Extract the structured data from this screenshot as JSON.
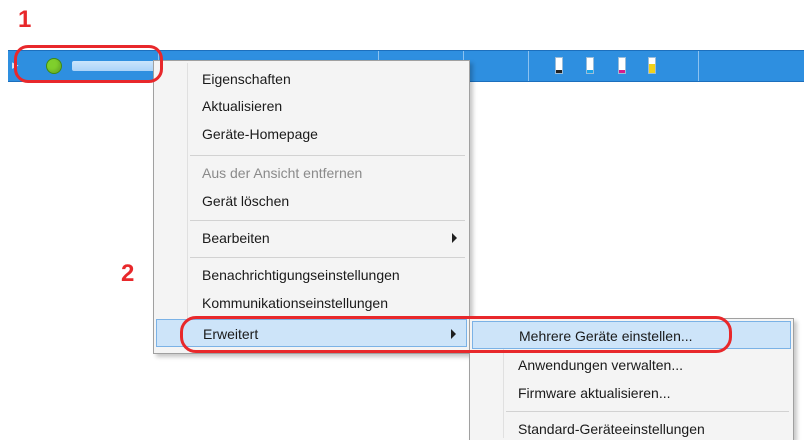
{
  "callouts": {
    "step1": "1",
    "step2": "2"
  },
  "colors": {
    "accent_red": "#e8282b",
    "row_blue": "#2e8fe0",
    "status_green": "#7fcf2c",
    "highlight": "#cde4f9"
  },
  "device_row": {
    "status_icon": "green-status-dot-icon",
    "expand_icon": "chevron-right-icon",
    "toner_levels": [
      {
        "name": "black-toner-icon",
        "color": "#222222",
        "level": 0.2
      },
      {
        "name": "cyan-toner-icon",
        "color": "#1aa3e8",
        "level": 0.2
      },
      {
        "name": "magenta-toner-icon",
        "color": "#d81b8c",
        "level": 0.2
      },
      {
        "name": "yellow-toner-icon",
        "color": "#f2d21a",
        "level": 0.6
      }
    ]
  },
  "context_menu": {
    "items": [
      {
        "label": "Eigenschaften"
      },
      {
        "label": "Aktualisieren"
      },
      {
        "label": "Geräte-Homepage"
      },
      {
        "label": "Aus der Ansicht entfernen",
        "disabled": true
      },
      {
        "label": "Gerät löschen"
      },
      {
        "label": "Bearbeiten",
        "submenu": true
      },
      {
        "label": "Benachrichtigungseinstellungen"
      },
      {
        "label": "Kommunikationseinstellungen"
      },
      {
        "label": "Erweitert",
        "submenu": true,
        "highlighted": true
      }
    ]
  },
  "submenu": {
    "items": [
      {
        "label": "Mehrere Geräte einstellen...",
        "highlighted": true
      },
      {
        "label": "Anwendungen verwalten..."
      },
      {
        "label": "Firmware aktualisieren..."
      },
      {
        "label": "Standard-Geräteeinstellungen"
      }
    ]
  }
}
